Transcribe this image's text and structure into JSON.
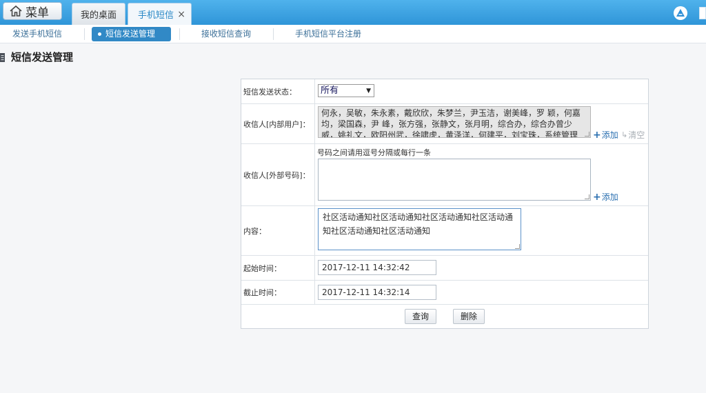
{
  "menu": {
    "label": "菜单",
    "home_icon": "home-icon"
  },
  "tabs": [
    {
      "label": "我的桌面"
    },
    {
      "label": "手机短信",
      "close": "×"
    }
  ],
  "subnav": {
    "items": [
      {
        "label": "发送手机短信"
      },
      {
        "label": "短信发送管理"
      },
      {
        "label": "接收短信查询"
      },
      {
        "label": "手机短信平台注册"
      }
    ]
  },
  "page": {
    "title": "短信发送管理"
  },
  "form": {
    "status": {
      "label": "短信发送状态：",
      "value": "所有"
    },
    "inner": {
      "label": "收信人[内部用户]：",
      "value": "何永，吴敏，朱永素，戴欣欣，朱梦兰，尹玉洁，谢美峰，罗 颖，何嘉均，梁国森，尹 峰，张方强，张静文，张月明，综合办，综合办曾少威，姚礼文，欧阳州武，徐啸虎，黄泽洋，何建平，刘宝珠，系统管理员，",
      "add": "添加",
      "clear": "清空"
    },
    "outer": {
      "label": "收信人[外部号码]：",
      "hint": "号码之间请用逗号分隔或每行一条",
      "value": "",
      "add": "添加"
    },
    "content": {
      "label": "内容：",
      "value": "社区活动通知社区活动通知社区活动通知社区活动通知社区活动通知社区活动通知"
    },
    "start": {
      "label": "起始时间：",
      "value": "2017-12-11 14:32:42"
    },
    "end": {
      "label": "截止时间：",
      "value": "2017-12-11 14:32:14"
    },
    "actions": {
      "query": "查询",
      "delete": "删除"
    }
  },
  "colors": {
    "topbar": "#3aa2e0",
    "active_subnav": "#3189c6",
    "link": "#2a6fb0"
  }
}
